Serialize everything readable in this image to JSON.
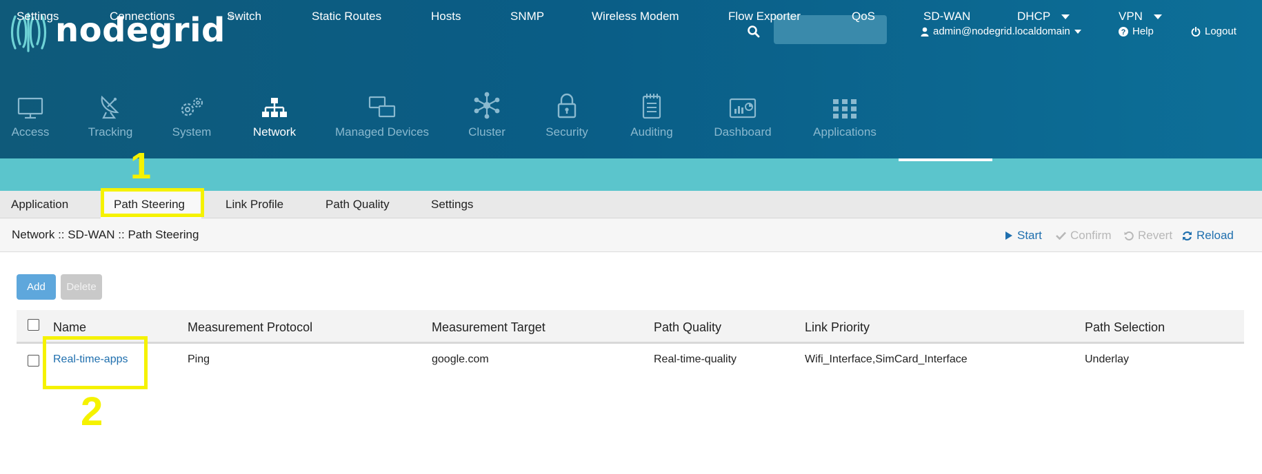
{
  "header": {
    "brand": "nodegrid",
    "brand_mark": "®",
    "search": {
      "placeholder": "",
      "value": ""
    },
    "user": "admin@nodegrid.localdomain",
    "help": "Help",
    "logout": "Logout"
  },
  "main_nav": [
    {
      "label": "Access",
      "icon": "monitor-icon"
    },
    {
      "label": "Tracking",
      "icon": "satellite-dish-icon"
    },
    {
      "label": "System",
      "icon": "gears-icon"
    },
    {
      "label": "Network",
      "icon": "network-topology-icon",
      "active": true
    },
    {
      "label": "Managed Devices",
      "icon": "managed-devices-icon"
    },
    {
      "label": "Cluster",
      "icon": "cluster-icon"
    },
    {
      "label": "Security",
      "icon": "lock-icon"
    },
    {
      "label": "Auditing",
      "icon": "notepad-icon"
    },
    {
      "label": "Dashboard",
      "icon": "dashboard-icon"
    },
    {
      "label": "Applications",
      "icon": "grid-apps-icon"
    }
  ],
  "sub_nav": [
    {
      "label": "Settings"
    },
    {
      "label": "Connections"
    },
    {
      "label": "Switch"
    },
    {
      "label": "Static Routes"
    },
    {
      "label": "Hosts"
    },
    {
      "label": "SNMP"
    },
    {
      "label": "Wireless Modem"
    },
    {
      "label": "Flow Exporter"
    },
    {
      "label": "QoS"
    },
    {
      "label": "SD-WAN",
      "active": true
    },
    {
      "label": "DHCP",
      "dropdown": true
    },
    {
      "label": "VPN",
      "dropdown": true
    }
  ],
  "tabs": [
    {
      "label": "Application"
    },
    {
      "label": "Path Steering",
      "active": true
    },
    {
      "label": "Link Profile"
    },
    {
      "label": "Path Quality"
    },
    {
      "label": "Settings"
    }
  ],
  "breadcrumb": "Network :: SD-WAN :: Path Steering",
  "actions": {
    "start": "Start",
    "confirm": "Confirm",
    "revert": "Revert",
    "reload": "Reload"
  },
  "buttons": {
    "add": "Add",
    "delete": "Delete"
  },
  "table": {
    "columns": [
      "Name",
      "Measurement Protocol",
      "Measurement Target",
      "Path Quality",
      "Link Priority",
      "Path Selection"
    ],
    "rows": [
      [
        "Real-time-apps",
        "Ping",
        "google.com",
        "Real-time-quality",
        "Wifi_Interface,SimCard_Interface",
        "Underlay"
      ]
    ]
  },
  "annotations": {
    "first": "1",
    "second": "2",
    "color": "#f5f200"
  },
  "colors": {
    "header": "#0a5d86",
    "subnav": "#5bc5cc",
    "link": "#1f6fae",
    "add_button": "#5ea7dc"
  }
}
